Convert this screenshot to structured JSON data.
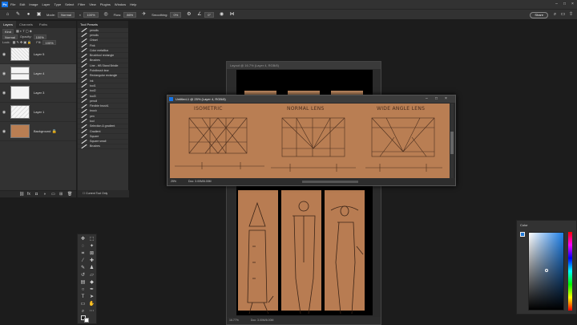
{
  "menubar": {
    "items": [
      "File",
      "Edit",
      "Image",
      "Layer",
      "Type",
      "Select",
      "Filter",
      "View",
      "Plugins",
      "Window",
      "Help"
    ],
    "logo": "Ps"
  },
  "options": {
    "mode_label": "Mode:",
    "mode_value": "Normal",
    "opacity_value": "100%",
    "flow_label": "Flow:",
    "flow_value": "86%",
    "smoothing_label": "Smoothing:",
    "smoothing_value": "0%",
    "angle_value": "0°",
    "share_label": "Share"
  },
  "layers_panel": {
    "tabs": [
      "Layers",
      "Channels",
      "Paths"
    ],
    "kind_value": "Kind",
    "blend_value": "Normal",
    "opacity_label": "Opacity:",
    "opacity_value": "100%",
    "lock_label": "Lock:",
    "fill_label": "Fill:",
    "fill_value": "100%",
    "layers": [
      {
        "name": "Layer 5",
        "selected": false
      },
      {
        "name": "Layer 4",
        "selected": true
      },
      {
        "name": "Layer 3",
        "selected": false
      },
      {
        "name": "Layer 1",
        "selected": false
      },
      {
        "name": "Background",
        "selected": false
      }
    ]
  },
  "tool_presets": {
    "title": "Tool Presets",
    "items": [
      "pencils",
      "pencils",
      "Chisel",
      "Fink",
      "Color metallica",
      "Brushtool rectangle",
      "Brushes",
      "Line - HB Stand Bristle",
      "Pointbrush tear",
      "Rectangular rectangle",
      "ink",
      "tool1",
      "tool2",
      "tool3",
      "pencil",
      "Flexible brush1",
      "brush",
      "pen",
      "tool",
      "Selection & gradient",
      "Gradient",
      "Square",
      "Square small",
      "Brushes"
    ],
    "footer": "Current Tool Only"
  },
  "front_document": {
    "title": "Untitled-1 @ 25% (Layer 4, RGB/8)",
    "zoom": "25%",
    "doc_info": "Doc: 3.00M/6.00M",
    "labels": [
      "ISOMETRIC",
      "NORMAL LENS",
      "WIDE ANGLE LENS"
    ]
  },
  "back_document": {
    "title": "Layout @ 16.7% (Layer 4, RGB/8)",
    "zoom": "16.77%",
    "doc_info": "Doc: 3.00M/6.00M"
  },
  "color_panel": {
    "title": "Color",
    "foreground": "#1e78d8",
    "background": "#ffffff"
  },
  "colors": {
    "canvas": "#b97e53",
    "chrome": "#323232",
    "workspace": "#1c1c1c"
  }
}
